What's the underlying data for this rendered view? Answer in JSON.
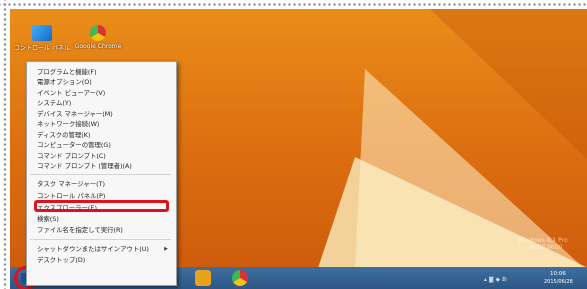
{
  "desktop_icons": [
    {
      "label": "コントロール パネル",
      "icon": "control-panel-icon"
    },
    {
      "label": "Google Chrome",
      "icon": "chrome-icon"
    }
  ],
  "context_menu": {
    "groups": [
      [
        "プログラムと機能(F)",
        "電源オプション(O)",
        "イベント ビューアー(V)",
        "システム(Y)",
        "デバイス マネージャー(M)",
        "ネットワーク接続(W)",
        "ディスクの管理(K)",
        "コンピューターの管理(G)",
        "コマンド プロンプト(C)",
        "コマンド プロンプト (管理者)(A)"
      ],
      [
        "タスク マネージャー(T)",
        "コントロール パネル(P)",
        "エクスプローラー(E)",
        "検索(S)",
        "ファイル名を指定して実行(R)"
      ],
      [
        "シャットダウンまたはサインアウト(U)",
        "デスクトップ(D)"
      ]
    ],
    "highlighted_item": "コントロール パネル(P)",
    "submenu_item": "シャットダウンまたはサインアウト(U)"
  },
  "watermark": {
    "line1": "Windows 8.1 Pro",
    "line2": "Build 9600"
  },
  "tray": {
    "time": "10:06",
    "date": "2015/06/28"
  },
  "colors": {
    "desktop": "#e07a14",
    "taskbar": "#2f5d8c",
    "highlight": "#e0101c"
  }
}
